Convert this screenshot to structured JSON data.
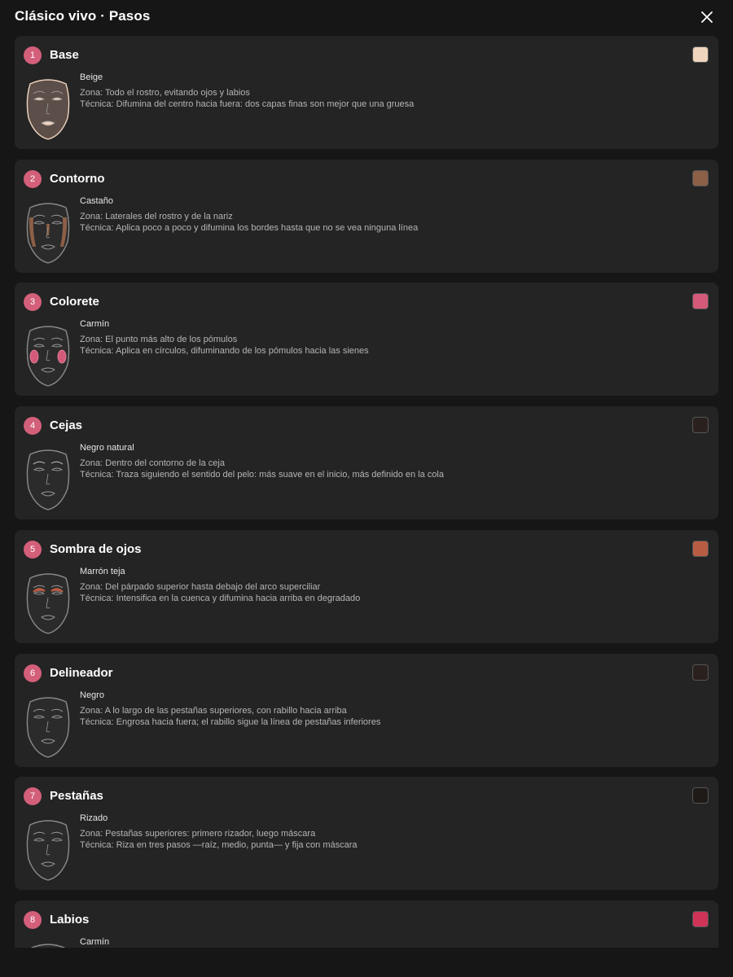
{
  "header": {
    "title": "Clásico vivo · Pasos",
    "close_icon": "close-icon"
  },
  "steps": [
    {
      "number": "1",
      "title": "Base",
      "color_name": "Beige",
      "swatch": "#efd5bd",
      "zone": "Zona: Todo el rostro, evitando ojos y labios",
      "technique": "Técnica: Difumina del centro hacia fuera: dos capas finas son mejor que una gruesa",
      "highlight": "base",
      "accent": "#efd5bd"
    },
    {
      "number": "2",
      "title": "Contorno",
      "color_name": "Castaño",
      "swatch": "#8c5f47",
      "zone": "Zona: Laterales del rostro y de la nariz",
      "technique": "Técnica: Aplica poco a poco y difumina los bordes hasta que no se vea ninguna línea",
      "highlight": "contour",
      "accent": "#8c5f47"
    },
    {
      "number": "3",
      "title": "Colorete",
      "color_name": "Carmín",
      "swatch": "#d45a7a",
      "zone": "Zona: El punto más alto de los pómulos",
      "technique": "Técnica: Aplica en círculos, difuminando de los pómulos hacia las sienes",
      "highlight": "blush",
      "accent": "#d45a7a"
    },
    {
      "number": "4",
      "title": "Cejas",
      "color_name": "Negro natural",
      "swatch": "#2a211e",
      "zone": "Zona: Dentro del contorno de la ceja",
      "technique": "Técnica: Traza siguiendo el sentido del pelo: más suave en el inicio, más definido en la cola",
      "highlight": "brows",
      "accent": "#2a211e"
    },
    {
      "number": "5",
      "title": "Sombra de ojos",
      "color_name": "Marrón teja",
      "swatch": "#b85d43",
      "zone": "Zona: Del párpado superior hasta debajo del arco superciliar",
      "technique": "Técnica: Intensifica en la cuenca y difumina hacia arriba en degradado",
      "highlight": "shadow",
      "accent": "#b85d43"
    },
    {
      "number": "6",
      "title": "Delineador",
      "color_name": "Negro",
      "swatch": "#2a211e",
      "zone": "Zona: A lo largo de las pestañas superiores, con rabillo hacia arriba",
      "technique": "Técnica: Engrosa hacia fuera; el rabillo sigue la línea de pestañas inferiores",
      "highlight": "liner",
      "accent": "#2a211e"
    },
    {
      "number": "7",
      "title": "Pestañas",
      "color_name": "Rizado",
      "swatch": "#1f1a18",
      "zone": "Zona: Pestañas superiores: primero rizador, luego máscara",
      "technique": "Técnica: Riza en tres pasos —raíz, medio, punta— y fija con máscara",
      "highlight": "lashes",
      "accent": "#1f1a18"
    },
    {
      "number": "8",
      "title": "Labios",
      "color_name": "Carmín",
      "swatch": "#cf3358",
      "zone": "",
      "technique": "",
      "highlight": "lips",
      "accent": "#cf3358"
    }
  ]
}
